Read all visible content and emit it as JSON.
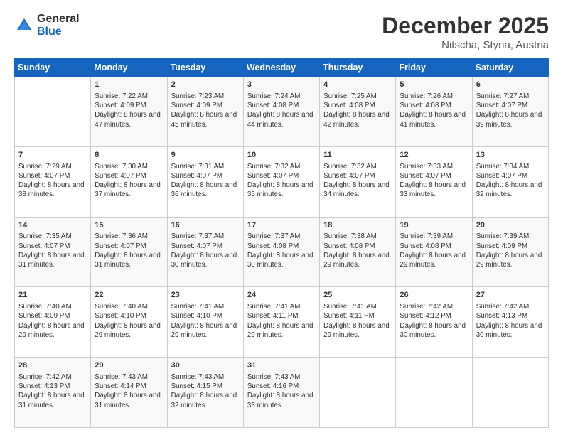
{
  "logo": {
    "general": "General",
    "blue": "Blue"
  },
  "header": {
    "title": "December 2025",
    "subtitle": "Nitscha, Styria, Austria"
  },
  "columns": [
    "Sunday",
    "Monday",
    "Tuesday",
    "Wednesday",
    "Thursday",
    "Friday",
    "Saturday"
  ],
  "weeks": [
    [
      {
        "day": "",
        "sunrise": "",
        "sunset": "",
        "daylight": ""
      },
      {
        "day": "1",
        "sunrise": "Sunrise: 7:22 AM",
        "sunset": "Sunset: 4:09 PM",
        "daylight": "Daylight: 8 hours and 47 minutes."
      },
      {
        "day": "2",
        "sunrise": "Sunrise: 7:23 AM",
        "sunset": "Sunset: 4:09 PM",
        "daylight": "Daylight: 8 hours and 45 minutes."
      },
      {
        "day": "3",
        "sunrise": "Sunrise: 7:24 AM",
        "sunset": "Sunset: 4:08 PM",
        "daylight": "Daylight: 8 hours and 44 minutes."
      },
      {
        "day": "4",
        "sunrise": "Sunrise: 7:25 AM",
        "sunset": "Sunset: 4:08 PM",
        "daylight": "Daylight: 8 hours and 42 minutes."
      },
      {
        "day": "5",
        "sunrise": "Sunrise: 7:26 AM",
        "sunset": "Sunset: 4:08 PM",
        "daylight": "Daylight: 8 hours and 41 minutes."
      },
      {
        "day": "6",
        "sunrise": "Sunrise: 7:27 AM",
        "sunset": "Sunset: 4:07 PM",
        "daylight": "Daylight: 8 hours and 39 minutes."
      }
    ],
    [
      {
        "day": "7",
        "sunrise": "Sunrise: 7:29 AM",
        "sunset": "Sunset: 4:07 PM",
        "daylight": "Daylight: 8 hours and 38 minutes."
      },
      {
        "day": "8",
        "sunrise": "Sunrise: 7:30 AM",
        "sunset": "Sunset: 4:07 PM",
        "daylight": "Daylight: 8 hours and 37 minutes."
      },
      {
        "day": "9",
        "sunrise": "Sunrise: 7:31 AM",
        "sunset": "Sunset: 4:07 PM",
        "daylight": "Daylight: 8 hours and 36 minutes."
      },
      {
        "day": "10",
        "sunrise": "Sunrise: 7:32 AM",
        "sunset": "Sunset: 4:07 PM",
        "daylight": "Daylight: 8 hours and 35 minutes."
      },
      {
        "day": "11",
        "sunrise": "Sunrise: 7:32 AM",
        "sunset": "Sunset: 4:07 PM",
        "daylight": "Daylight: 8 hours and 34 minutes."
      },
      {
        "day": "12",
        "sunrise": "Sunrise: 7:33 AM",
        "sunset": "Sunset: 4:07 PM",
        "daylight": "Daylight: 8 hours and 33 minutes."
      },
      {
        "day": "13",
        "sunrise": "Sunrise: 7:34 AM",
        "sunset": "Sunset: 4:07 PM",
        "daylight": "Daylight: 8 hours and 32 minutes."
      }
    ],
    [
      {
        "day": "14",
        "sunrise": "Sunrise: 7:35 AM",
        "sunset": "Sunset: 4:07 PM",
        "daylight": "Daylight: 8 hours and 31 minutes."
      },
      {
        "day": "15",
        "sunrise": "Sunrise: 7:36 AM",
        "sunset": "Sunset: 4:07 PM",
        "daylight": "Daylight: 8 hours and 31 minutes."
      },
      {
        "day": "16",
        "sunrise": "Sunrise: 7:37 AM",
        "sunset": "Sunset: 4:07 PM",
        "daylight": "Daylight: 8 hours and 30 minutes."
      },
      {
        "day": "17",
        "sunrise": "Sunrise: 7:37 AM",
        "sunset": "Sunset: 4:08 PM",
        "daylight": "Daylight: 8 hours and 30 minutes."
      },
      {
        "day": "18",
        "sunrise": "Sunrise: 7:38 AM",
        "sunset": "Sunset: 4:08 PM",
        "daylight": "Daylight: 8 hours and 29 minutes."
      },
      {
        "day": "19",
        "sunrise": "Sunrise: 7:39 AM",
        "sunset": "Sunset: 4:08 PM",
        "daylight": "Daylight: 8 hours and 29 minutes."
      },
      {
        "day": "20",
        "sunrise": "Sunrise: 7:39 AM",
        "sunset": "Sunset: 4:09 PM",
        "daylight": "Daylight: 8 hours and 29 minutes."
      }
    ],
    [
      {
        "day": "21",
        "sunrise": "Sunrise: 7:40 AM",
        "sunset": "Sunset: 4:09 PM",
        "daylight": "Daylight: 8 hours and 29 minutes."
      },
      {
        "day": "22",
        "sunrise": "Sunrise: 7:40 AM",
        "sunset": "Sunset: 4:10 PM",
        "daylight": "Daylight: 8 hours and 29 minutes."
      },
      {
        "day": "23",
        "sunrise": "Sunrise: 7:41 AM",
        "sunset": "Sunset: 4:10 PM",
        "daylight": "Daylight: 8 hours and 29 minutes."
      },
      {
        "day": "24",
        "sunrise": "Sunrise: 7:41 AM",
        "sunset": "Sunset: 4:11 PM",
        "daylight": "Daylight: 8 hours and 29 minutes."
      },
      {
        "day": "25",
        "sunrise": "Sunrise: 7:41 AM",
        "sunset": "Sunset: 4:11 PM",
        "daylight": "Daylight: 8 hours and 29 minutes."
      },
      {
        "day": "26",
        "sunrise": "Sunrise: 7:42 AM",
        "sunset": "Sunset: 4:12 PM",
        "daylight": "Daylight: 8 hours and 30 minutes."
      },
      {
        "day": "27",
        "sunrise": "Sunrise: 7:42 AM",
        "sunset": "Sunset: 4:13 PM",
        "daylight": "Daylight: 8 hours and 30 minutes."
      }
    ],
    [
      {
        "day": "28",
        "sunrise": "Sunrise: 7:42 AM",
        "sunset": "Sunset: 4:13 PM",
        "daylight": "Daylight: 8 hours and 31 minutes."
      },
      {
        "day": "29",
        "sunrise": "Sunrise: 7:43 AM",
        "sunset": "Sunset: 4:14 PM",
        "daylight": "Daylight: 8 hours and 31 minutes."
      },
      {
        "day": "30",
        "sunrise": "Sunrise: 7:43 AM",
        "sunset": "Sunset: 4:15 PM",
        "daylight": "Daylight: 8 hours and 32 minutes."
      },
      {
        "day": "31",
        "sunrise": "Sunrise: 7:43 AM",
        "sunset": "Sunset: 4:16 PM",
        "daylight": "Daylight: 8 hours and 33 minutes."
      },
      {
        "day": "",
        "sunrise": "",
        "sunset": "",
        "daylight": ""
      },
      {
        "day": "",
        "sunrise": "",
        "sunset": "",
        "daylight": ""
      },
      {
        "day": "",
        "sunrise": "",
        "sunset": "",
        "daylight": ""
      }
    ]
  ]
}
